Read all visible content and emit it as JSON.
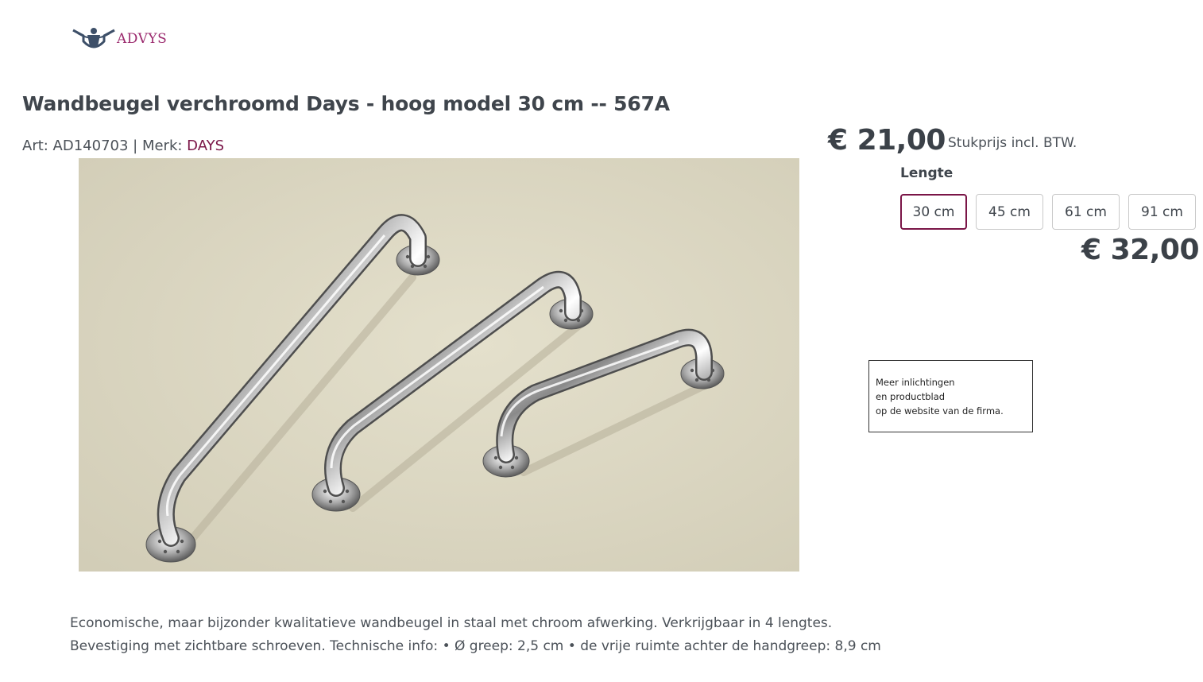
{
  "header": {
    "logo_text": "ADVYS",
    "logo_icon": "advys-figure-logo-icon"
  },
  "product": {
    "title": "Wandbeugel verchroomd Days - hoog model 30 cm -- 567A",
    "art_label": "Art: AD140703 | Merk: ",
    "brand": "DAYS",
    "image_alt": "Drie verchroomde wandbeugels",
    "price": "€ 21,00",
    "price_note": "Stukprijs incl. BTW.",
    "option_label": "Lengte",
    "options": [
      {
        "label": "30 cm",
        "selected": true
      },
      {
        "label": "45 cm",
        "selected": false
      },
      {
        "label": "61 cm",
        "selected": false
      },
      {
        "label": "91 cm",
        "selected": false
      }
    ],
    "secondary_price": "€ 32,00"
  },
  "info_box": {
    "line1": "Meer inlichtingen",
    "line2": "en productblad",
    "line3": "op de website van de firma."
  },
  "description": {
    "line1": "Economische, maar bijzonder kwalitatieve wandbeugel in staal met chroom afwerking. Verkrijgbaar in 4 lengtes.",
    "line2": "Bevestiging met zichtbare schroeven. Technische info: • Ø greep: 2,5 cm • de vrije ruimte achter de handgreep: 8,9 cm"
  },
  "colors": {
    "accent": "#7a1547",
    "logo": "#9b2a6e",
    "text": "#444b52",
    "image_background": "#dcd8c4"
  }
}
